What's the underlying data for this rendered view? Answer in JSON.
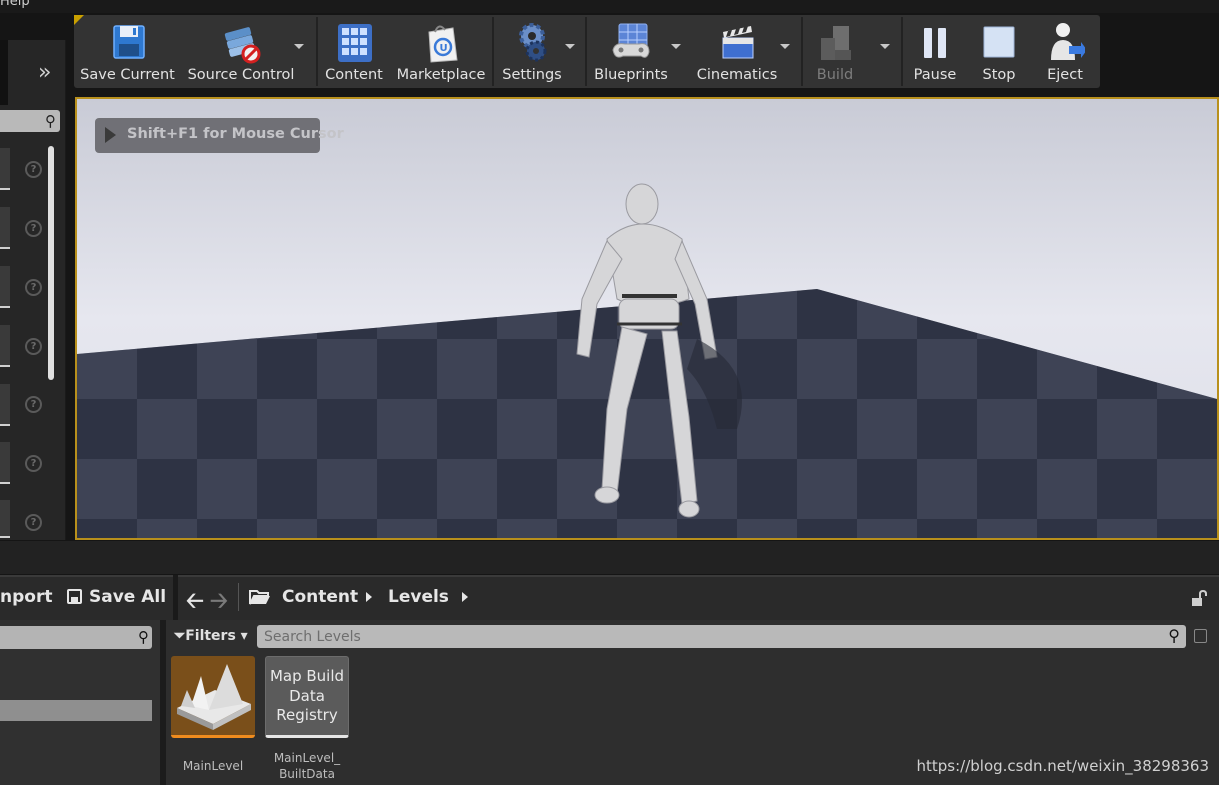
{
  "menu": {
    "help_fragment": "Help"
  },
  "toolbar": {
    "buttons": [
      {
        "label": "Save Current",
        "icon": "save-disk-icon"
      },
      {
        "label": "Source Control",
        "icon": "source-control-icon"
      },
      {
        "label": "Content",
        "icon": "content-grid-icon"
      },
      {
        "label": "Marketplace",
        "icon": "marketplace-bag-icon"
      },
      {
        "label": "Settings",
        "icon": "settings-gear-icon"
      },
      {
        "label": "Blueprints",
        "icon": "blueprints-icon"
      },
      {
        "label": "Cinematics",
        "icon": "clapperboard-icon"
      },
      {
        "label": "Build",
        "icon": "build-blocks-icon",
        "disabled": true
      },
      {
        "label": "Pause",
        "icon": "pause-icon"
      },
      {
        "label": "Stop",
        "icon": "stop-icon"
      },
      {
        "label": "Eject",
        "icon": "eject-person-icon"
      }
    ]
  },
  "viewport": {
    "hint": "Shift+F1 for Mouse Cursor"
  },
  "content_browser": {
    "import_label": "nport",
    "save_all_label": "Save All",
    "breadcrumb": [
      "Content",
      "Levels"
    ],
    "filters_label": "Filters",
    "search_placeholder": "Search Levels",
    "assets": [
      {
        "name": "MainLevel",
        "thumb_icon": "level-map-icon"
      },
      {
        "name": "MainLevel_\nBuiltData",
        "thumb_text": "Map Build Data Registry"
      }
    ]
  },
  "watermark": "https://blog.csdn.net/weixin_38298363",
  "colors": {
    "accent_gold": "#c9a000",
    "asset_orange": "#f08c1e",
    "panel_dark": "#2b2b2b"
  }
}
